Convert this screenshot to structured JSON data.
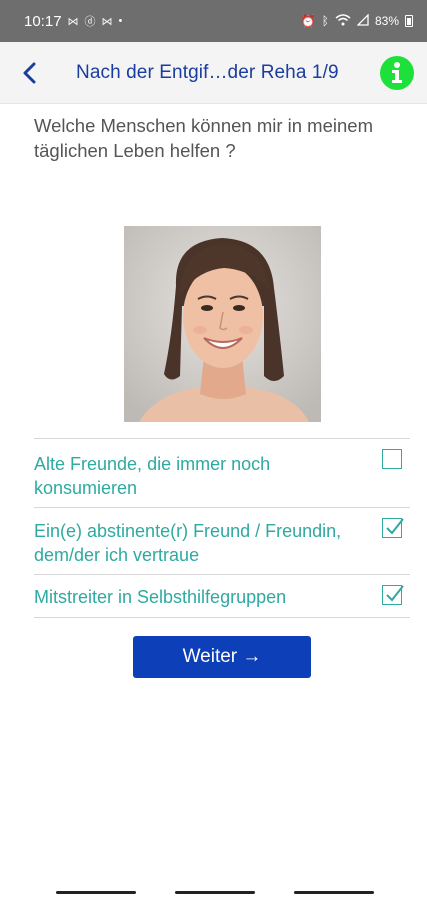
{
  "status_bar": {
    "time": "10:17",
    "battery": "83%",
    "icons_left": [
      "m-icon",
      "d-icon",
      "m-icon",
      "dot-icon"
    ],
    "icons_right": [
      "alarm-icon",
      "bluetooth-icon",
      "wifi-icon",
      "signal-icon",
      "battery-icon"
    ]
  },
  "header": {
    "title": "Nach der Entgif…der Reha 1/9",
    "back_icon": "chevron-left-icon",
    "info_icon": "info-icon"
  },
  "main": {
    "question": "Welche Menschen können mir in meinem täglichen Leben helfen ?",
    "options": [
      {
        "label": "Alte Freunde, die immer noch konsumieren",
        "checked": false
      },
      {
        "label": "Ein(e) abstinente(r) Freund / Freundin, dem/der ich vertraue",
        "checked": true
      },
      {
        "label": "Mitstreiter in Selbsthilfegruppen",
        "checked": true
      }
    ],
    "next_button": "Weiter →"
  },
  "colors": {
    "accent_blue": "#0d3fb8",
    "title_blue": "#1a3d9e",
    "option_teal": "#2eaaa0",
    "info_green": "#1ee03a"
  }
}
